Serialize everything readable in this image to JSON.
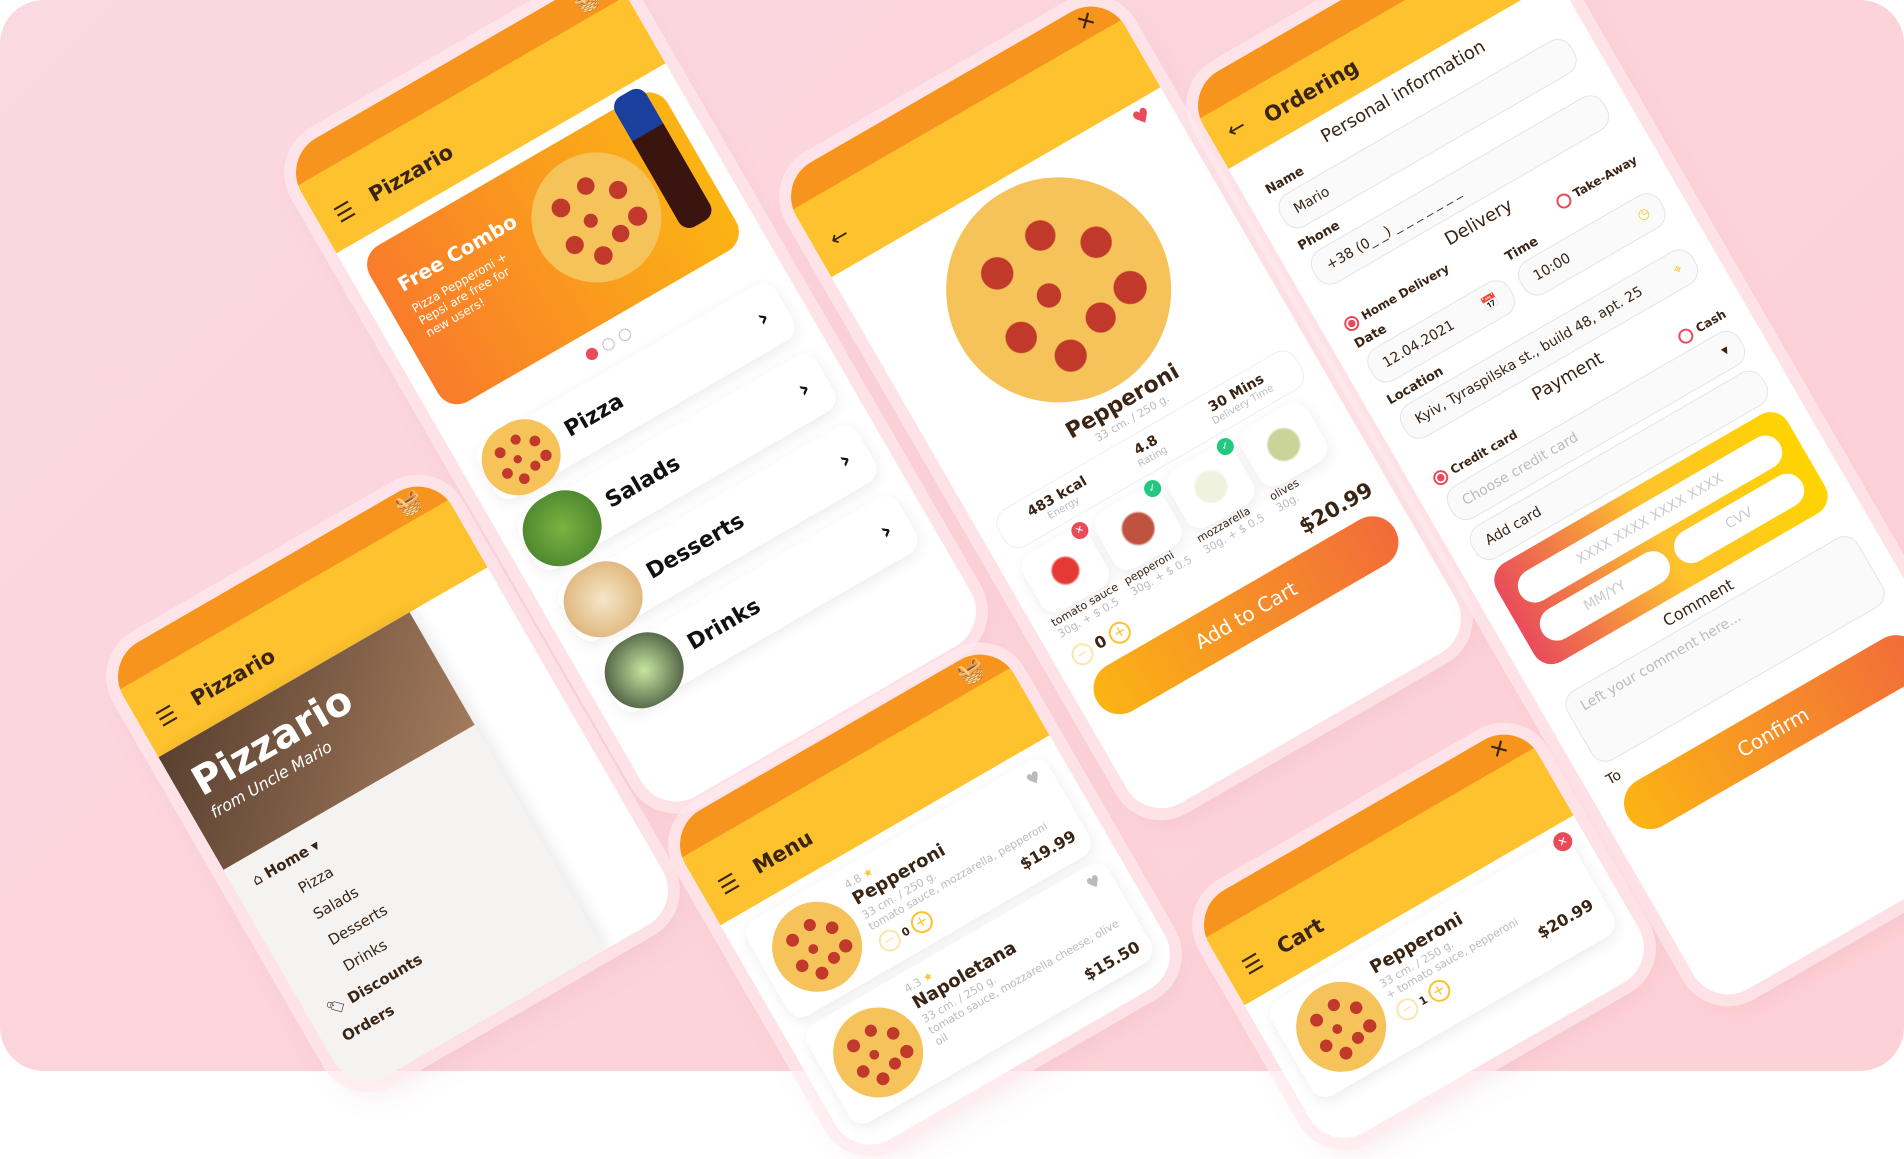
{
  "colors": {
    "orange": "#f7941d",
    "yellow": "#fdc22d",
    "red": "#e94b5b",
    "green": "#22c97f",
    "brown": "#3a2414"
  },
  "home": {
    "app_title": "Pizzario",
    "banner": {
      "title": "Free Combo",
      "text": "Pizza Pepperoni + Pepsi are free for new users!",
      "drink": "pepsi"
    },
    "categories": [
      "Pizza",
      "Salads",
      "Desserts",
      "Drinks"
    ]
  },
  "drawer": {
    "app_title": "Pizzario",
    "logo": "Pizzario",
    "logo_sub": "from Uncle Mario",
    "items": [
      "Home",
      "Pizza",
      "Salads",
      "Desserts",
      "Drinks",
      "Discounts",
      "Orders"
    ]
  },
  "product": {
    "name": "Pepperoni",
    "size": "33 cm. / 250 g.",
    "delivery": "30 Mins",
    "delivery_label": "Delivery Time",
    "rating": "4.8",
    "rating_label": "Rating",
    "energy": "483 kcal",
    "energy_label": "Energy",
    "ingredients": [
      {
        "name": "tomato sauce",
        "weight": "30g.",
        "price": "+ $ 0.5"
      },
      {
        "name": "pepperoni",
        "weight": "30g.",
        "price": "+ $ 0.5"
      },
      {
        "name": "mozzarella",
        "weight": "30g.",
        "price": "+ $ 0.5"
      },
      {
        "name": "olives",
        "weight": "30g.",
        "price": ""
      }
    ],
    "quantity": "0",
    "price": "$20.99",
    "add_to_cart": "Add to Cart"
  },
  "menu": {
    "title": "Menu",
    "items": [
      {
        "rating": "4.8",
        "name": "Pepperoni",
        "size": "33 cm. / 250 g.",
        "desc": "tomato sauce, mozzarella, pepperoni",
        "quantity": "0",
        "price": "$19.99"
      },
      {
        "rating": "4.3",
        "name": "Napoletana",
        "size": "33 cm. / 250 g.",
        "desc": "tomato sauce, mozzarella cheese, olive oil",
        "price": "$15.50"
      }
    ]
  },
  "ordering": {
    "title": "Ordering",
    "personal": "Personal information",
    "name_label": "Name",
    "name_value": "Mario",
    "phone_label": "Phone",
    "phone_value": "+38 (0_ _) _ _ _ _ _ _ _",
    "delivery": "Delivery",
    "home_delivery": "Home Delivery",
    "take_away": "Take-Away",
    "date_label": "Date",
    "date_value": "12.04.2021",
    "time_label": "Time",
    "time_value": "10:00",
    "location_label": "Location",
    "location_value": "Kyiv, Tyraspilska st., build 48, apt. 25",
    "payment": "Payment",
    "credit_card": "Credit card",
    "cash": "Cash",
    "choose_card": "Choose credit card",
    "add_card": "Add card",
    "card_number": "XXXX XXXX XXXX XXXX",
    "mmyy": "MM/YY",
    "cvv": "CVV",
    "comment": "Comment",
    "comment_placeholder": "Left your comment here...",
    "total": "To",
    "confirm": "Confirm"
  },
  "cart": {
    "title": "Cart",
    "items": [
      {
        "name": "Pepperoni",
        "size": "33 cm. / 250 g.",
        "desc": "+ tomato sauce, pepperoni",
        "quantity": "1",
        "price": "$20.99"
      }
    ]
  }
}
